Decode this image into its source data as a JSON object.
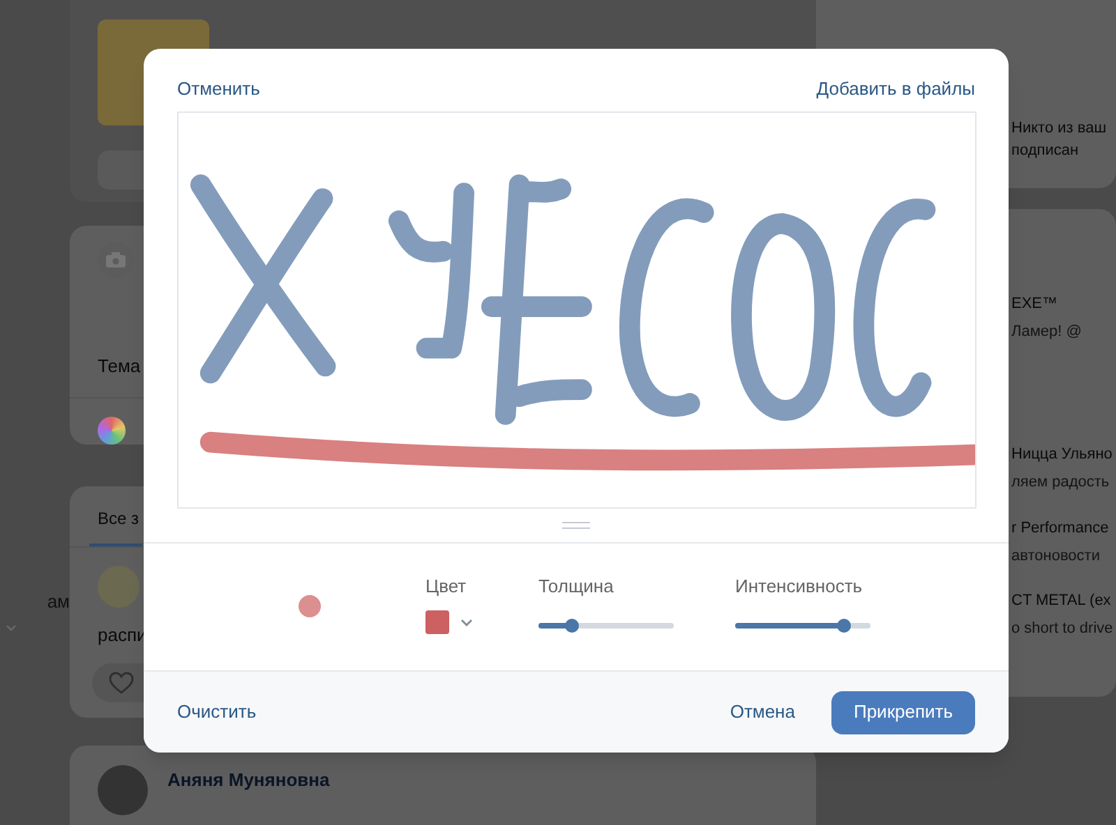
{
  "feed": {
    "sidebar_fragment": "ам",
    "topic_fragment": "Тема",
    "tabs": [
      {
        "label": "Все з",
        "selected": true
      }
    ],
    "post_fragment": "распи",
    "next_post_author": "Аняня Муняновна"
  },
  "right_column": {
    "notice": [
      "Никто из ваш",
      "подписан"
    ],
    "communities": [
      {
        "name": "EXE™",
        "subtitle": "Ламер! @"
      },
      {
        "name": "Ницца Ульяно",
        "subtitle": "ляем радость"
      },
      {
        "name": "r Performance",
        "subtitle": "автоновости"
      },
      {
        "name": "CT METAL (ex",
        "subtitle": "o short to drive"
      }
    ]
  },
  "modal": {
    "cancel_link": "Отменить",
    "save_link": "Добавить в файлы",
    "color": {
      "label": "Цвет",
      "color": "#cd6060"
    },
    "sliders": [
      {
        "label": "Толщина",
        "level": 0.25
      },
      {
        "label": "Интенсивность",
        "level": 0.8
      }
    ],
    "clear_link": "Очистить",
    "dismiss_button": "Отмена",
    "attach_button": "Прикрепить"
  }
}
